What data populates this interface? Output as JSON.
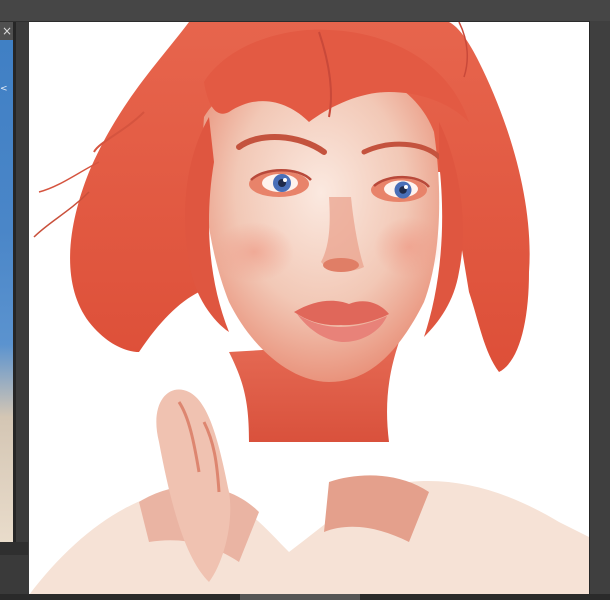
{
  "navigator": {
    "close_label": "×",
    "thumb_mark": "<"
  },
  "colors": {
    "hair": "#e8604a",
    "skin_light": "#f5dccf",
    "skin_warm": "#e88f78",
    "iris": "#4a6fb8",
    "background": "#ffffff",
    "ui_dark": "#3a3a3a"
  }
}
